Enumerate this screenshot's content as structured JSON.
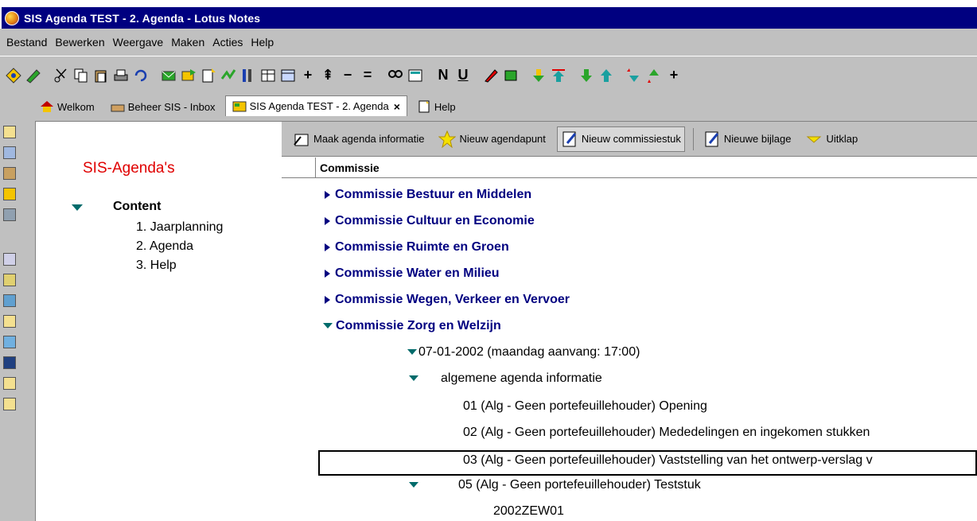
{
  "window": {
    "title": "SIS Agenda TEST - 2. Agenda - Lotus Notes"
  },
  "menu": [
    {
      "first": "B",
      "rest": "estand"
    },
    {
      "first": "B",
      "rest": "ewerken",
      "pre": "",
      "label": "Bewerken"
    },
    {
      "first": "W",
      "rest": "eergave"
    },
    {
      "first": "M",
      "rest": "aken"
    },
    {
      "first": "A",
      "rest": "cties"
    },
    {
      "first": "H",
      "rest": "elp"
    }
  ],
  "menu_labels": [
    "Bestand",
    "Bewerken",
    "Weergave",
    "Maken",
    "Acties",
    "Help"
  ],
  "toolbar_text": {
    "n": "N",
    "u": "U"
  },
  "tabs": [
    {
      "label": "Welkom"
    },
    {
      "label": "Beheer SIS - Inbox"
    },
    {
      "label": "SIS Agenda TEST - 2. Agenda",
      "close": "×"
    },
    {
      "label": "Help"
    }
  ],
  "nav": {
    "title": "SIS-Agenda's",
    "section": "Content",
    "items": [
      "1. Jaarplanning",
      "2. Agenda",
      "3. Help"
    ]
  },
  "actions": [
    {
      "label": "Maak agenda informatie"
    },
    {
      "label": "Nieuw agendapunt"
    },
    {
      "label": "Nieuw commissiestuk"
    },
    {
      "label": "Nieuwe bijlage"
    },
    {
      "label": "Uitklap"
    }
  ],
  "view": {
    "column": "Commissie",
    "categories": [
      "Commissie Bestuur en Middelen",
      "Commissie Cultuur en Economie",
      "Commissie Ruimte en Groen",
      "Commissie Water en Milieu",
      "Commissie Wegen, Verkeer en Vervoer",
      "Commissie Zorg en Welzijn"
    ],
    "date_row": "07-01-2002 (maandag  aanvang: 17:00)",
    "sub_category": "algemene agenda informatie",
    "entries": [
      "01  (Alg - Geen portefeuillehouder) Opening",
      "02  (Alg - Geen portefeuillehouder) Mededelingen en ingekomen stukken",
      "03  (Alg - Geen portefeuillehouder) Vaststelling van het ontwerp-verslag v",
      "05  (Alg - Geen portefeuillehouder) Teststuk"
    ],
    "doc_number": "2002ZEW01"
  },
  "colors": {
    "titlebar": "#000080",
    "nav_title": "#e00000",
    "category": "#000080",
    "twistie": "#006b6b"
  }
}
